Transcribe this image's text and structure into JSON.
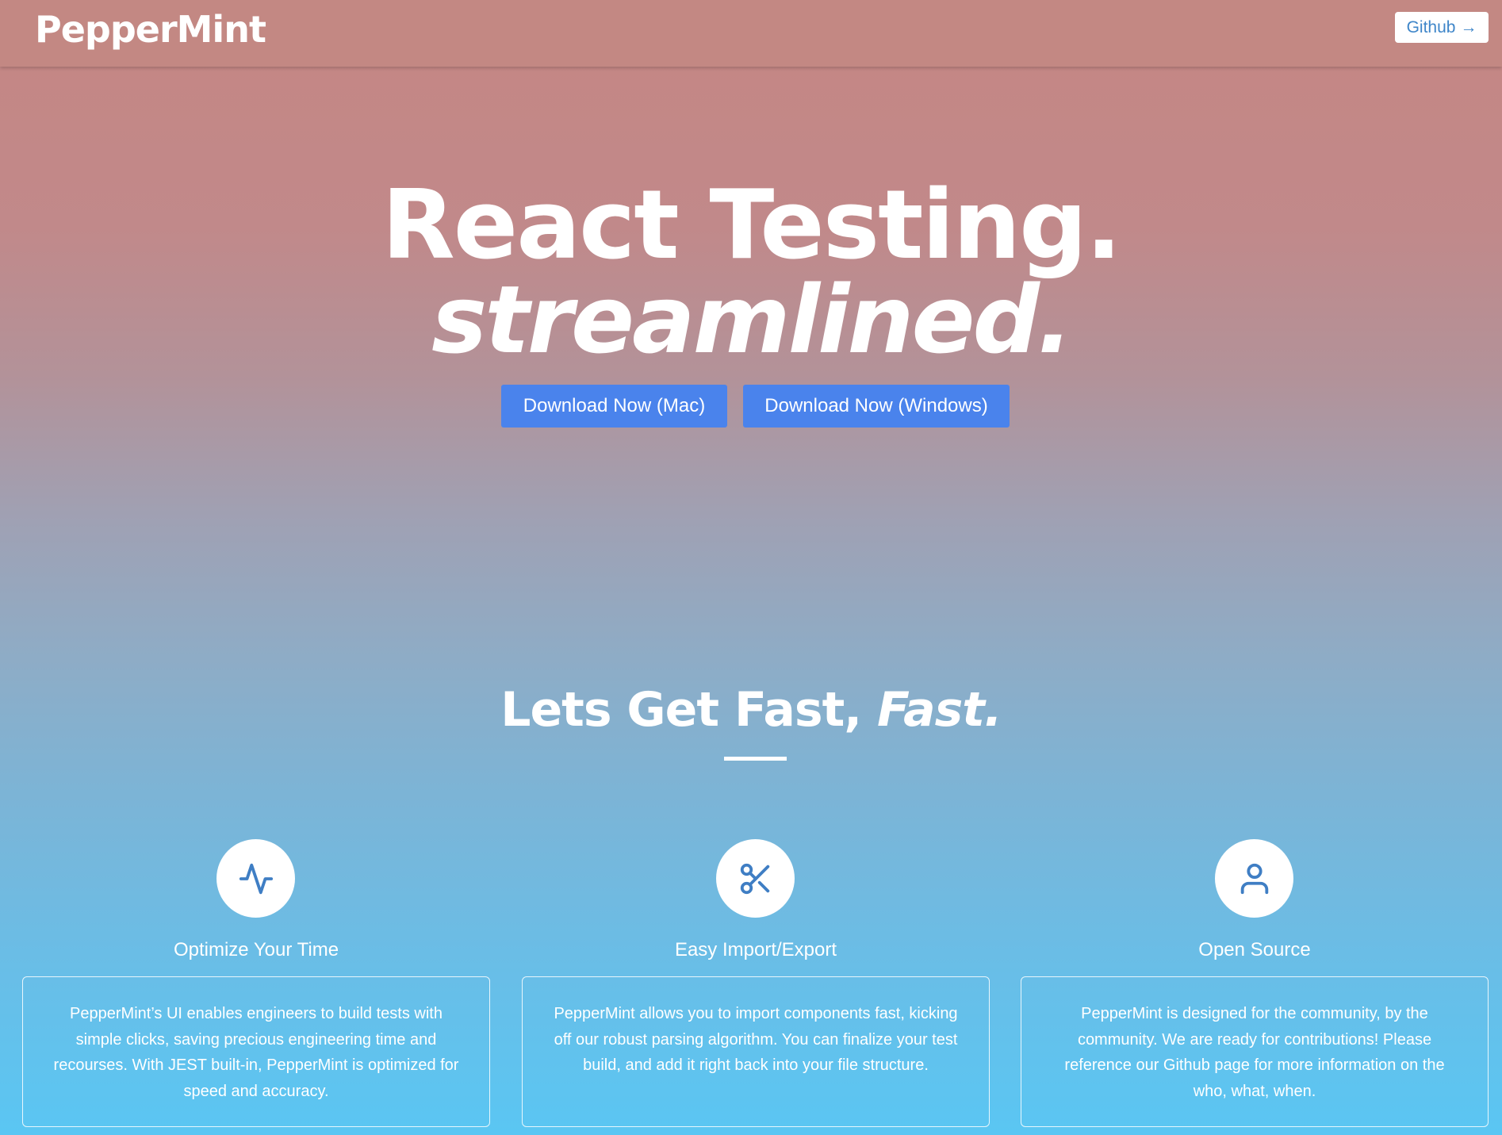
{
  "navbar": {
    "logo": "PepperMint",
    "github_label": "Github",
    "github_arrow": "→"
  },
  "hero": {
    "line1": "React Testing.",
    "line2": "streamlined.",
    "download_mac": "Download Now (Mac)",
    "download_windows": "Download Now (Windows)"
  },
  "features_section": {
    "title_plain": "Lets Get Fast, ",
    "title_italic": "Fast.",
    "items": [
      {
        "icon": "activity-icon",
        "title": "Optimize Your Time",
        "description": "PepperMint’s UI enables engineers to build tests with simple clicks, saving precious engineering time and recourses. With JEST built-in, PepperMint is optimized for speed and accuracy."
      },
      {
        "icon": "scissors-icon",
        "title": "Easy Import/Export",
        "description": "PepperMint allows you to import components fast, kicking off our robust parsing algorithm. You can finalize your test build, and add it right back into your file structure."
      },
      {
        "icon": "user-icon",
        "title": "Open Source",
        "description": "PepperMint is designed for the community, by the community. We are ready for contributions! Please reference our Github page for more information on the who, what, when."
      }
    ]
  },
  "colors": {
    "accent_blue": "#4a83ec",
    "icon_blue": "#3f7ec4",
    "navbar_bg": "#c38883",
    "gradient_bottom": "#5ac6f3"
  }
}
